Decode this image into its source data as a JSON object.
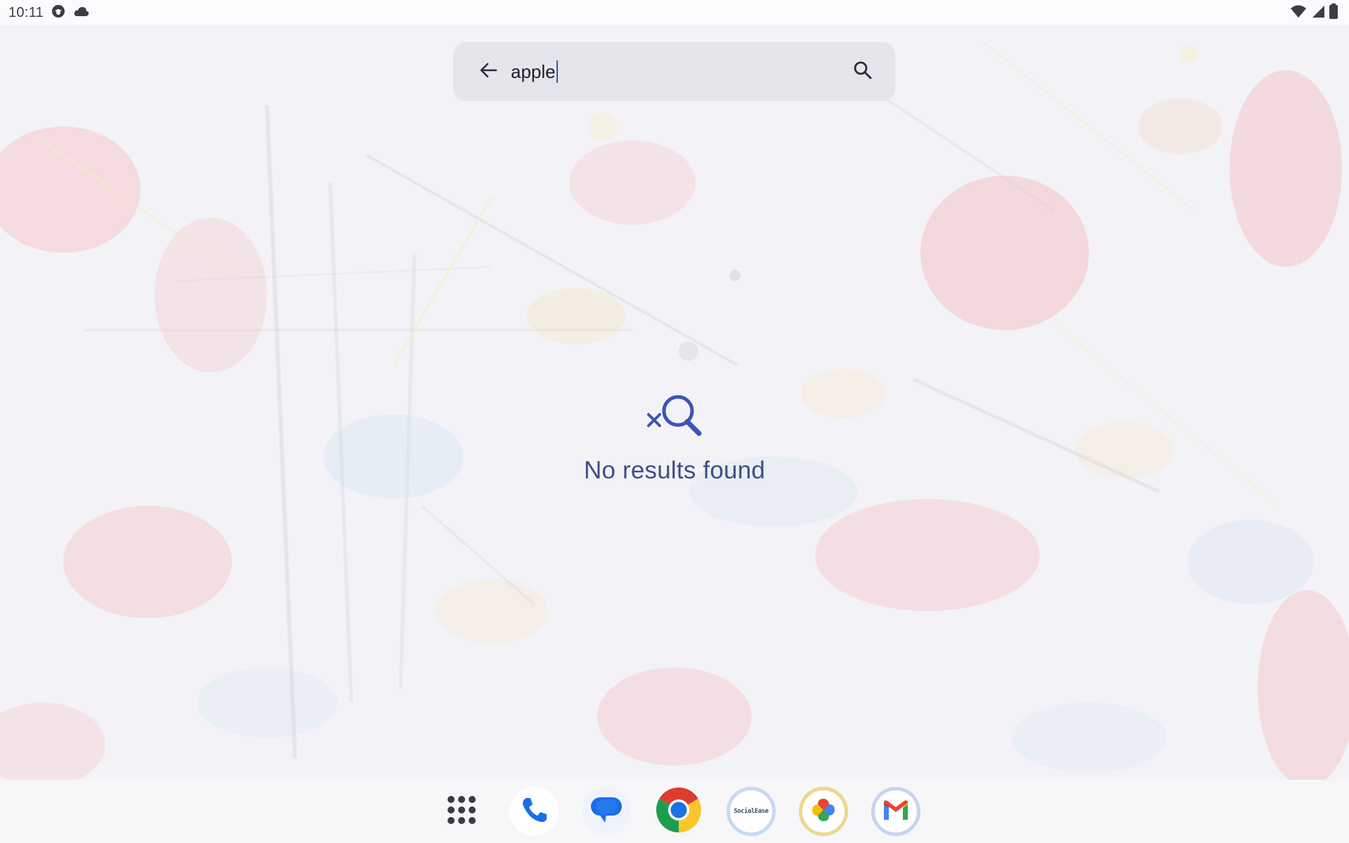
{
  "status_bar": {
    "time": "10:11",
    "left_icons": [
      "face-icon",
      "cloud-icon"
    ],
    "right_icons": [
      "wifi-icon",
      "signal-icon",
      "battery-icon"
    ]
  },
  "search": {
    "value": "apple",
    "back_icon": "arrow-back-icon",
    "search_icon": "search-icon"
  },
  "empty_state": {
    "icon": "search-off-icon",
    "message": "No results found"
  },
  "dock": {
    "apps": [
      {
        "name": "app-drawer",
        "icon": "grid-dots-icon"
      },
      {
        "name": "phone",
        "icon": "phone-icon"
      },
      {
        "name": "messages",
        "icon": "messages-icon"
      },
      {
        "name": "chrome",
        "icon": "chrome-icon"
      },
      {
        "name": "socialease",
        "icon": "socialease-icon",
        "label": "SocialEase"
      },
      {
        "name": "photos",
        "icon": "photos-icon"
      },
      {
        "name": "gmail",
        "icon": "gmail-icon"
      }
    ]
  },
  "colors": {
    "accent": "#3a55b4",
    "empty_text": "#3d4f86",
    "search_bg": "#e5e5ec"
  }
}
